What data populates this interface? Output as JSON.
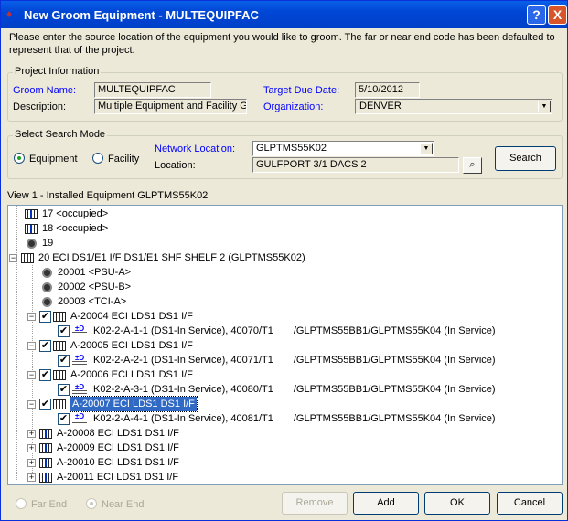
{
  "window": {
    "title": "New Groom Equipment - MULTEQUIPFAC",
    "help": "?",
    "close": "X"
  },
  "instructions": "Please enter the source location of the equipment you would like to groom. The far or near end code has been defaulted to represent that of the project.",
  "project": {
    "legend": "Project Information",
    "groom_name_label": "Groom Name:",
    "groom_name": "MULTEQUIPFAC",
    "description_label": "Description:",
    "description": "Multiple Equipment and Facility Gro",
    "due_label": "Target Due Date:",
    "due": "5/10/2012",
    "org_label": "Organization:",
    "org": "DENVER"
  },
  "search": {
    "legend": "Select Search Mode",
    "equipment": "Equipment",
    "facility": "Facility",
    "netloc_label": "Network Location:",
    "netloc": "GLPTMS55K02",
    "location_label": "Location:",
    "location": "GULFPORT 3/1 DACS 2",
    "search_btn": "Search"
  },
  "view_label": "View 1 - Installed Equipment  GLPTMS55K02",
  "tree": [
    {
      "text": "17 <occupied>"
    },
    {
      "text": "18 <occupied>"
    },
    {
      "text": "19"
    },
    {
      "text": "20 ECI DS1/E1 I/F DS1/E1 SHF SHELF 2  (GLPTMS55K02)"
    },
    {
      "text": "20001 <PSU-A>"
    },
    {
      "text": "20002 <PSU-B>"
    },
    {
      "text": "20003 <TCI-A>"
    },
    {
      "text": "A-20004 ECI LDS1 DS1 I/F"
    },
    {
      "text": "K02-2-A-1-1 (DS1-In Service), 40070/T1",
      "path": "/GLPTMS55BB1/GLPTMS55K04 (In Service)"
    },
    {
      "text": "A-20005 ECI LDS1 DS1 I/F"
    },
    {
      "text": "K02-2-A-2-1 (DS1-In Service), 40071/T1",
      "path": "/GLPTMS55BB1/GLPTMS55K04 (In Service)"
    },
    {
      "text": "A-20006 ECI LDS1 DS1 I/F"
    },
    {
      "text": "K02-2-A-3-1 (DS1-In Service), 40080/T1",
      "path": "/GLPTMS55BB1/GLPTMS55K04 (In Service)"
    },
    {
      "text": "A-20007 ECI LDS1 DS1 I/F"
    },
    {
      "text": "K02-2-A-4-1 (DS1-In Service), 40081/T1",
      "path": "/GLPTMS55BB1/GLPTMS55K04 (In Service)"
    },
    {
      "text": "A-20008 ECI LDS1 DS1 I/F"
    },
    {
      "text": "A-20009 ECI LDS1 DS1 I/F"
    },
    {
      "text": "A-20010 ECI LDS1 DS1 I/F"
    },
    {
      "text": "A-20011 ECI LDS1 DS1 I/F"
    }
  ],
  "footer": {
    "far_end": "Far End",
    "near_end": "Near End",
    "remove": "Remove",
    "add": "Add",
    "ok": "OK",
    "cancel": "Cancel"
  }
}
